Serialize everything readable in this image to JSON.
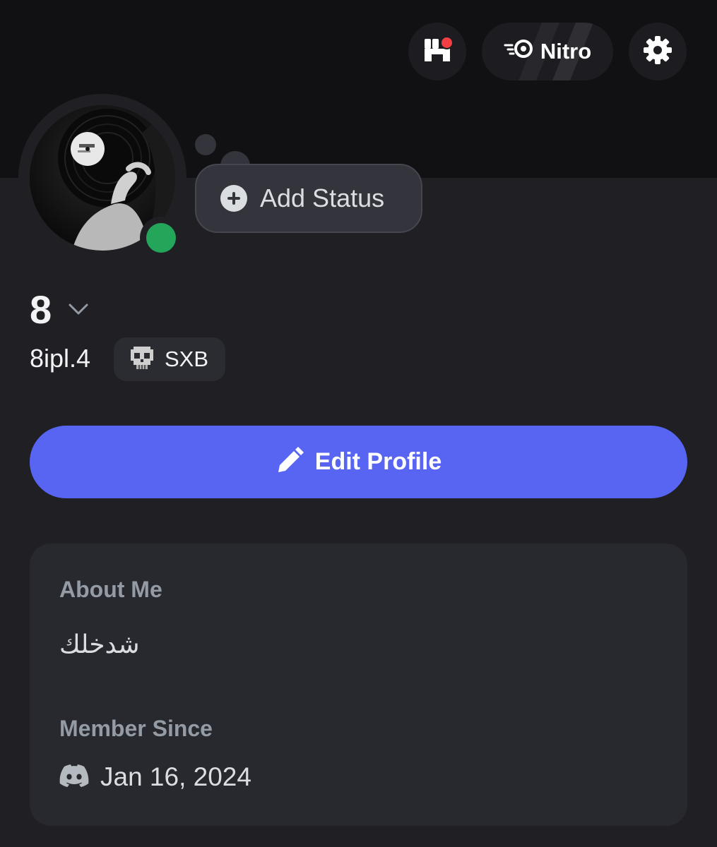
{
  "header": {
    "nitro_label": "Nitro"
  },
  "status": {
    "add_status_label": "Add Status",
    "online_color": "#23a55a"
  },
  "profile": {
    "display_name": "8",
    "username": "8ipl.4",
    "server_tag": "SXB"
  },
  "actions": {
    "edit_profile_label": "Edit Profile",
    "accent_color": "#5865f2"
  },
  "about": {
    "heading": "About Me",
    "text": "شدخلك"
  },
  "member_since": {
    "heading": "Member Since",
    "date": "Jan 16, 2024"
  }
}
